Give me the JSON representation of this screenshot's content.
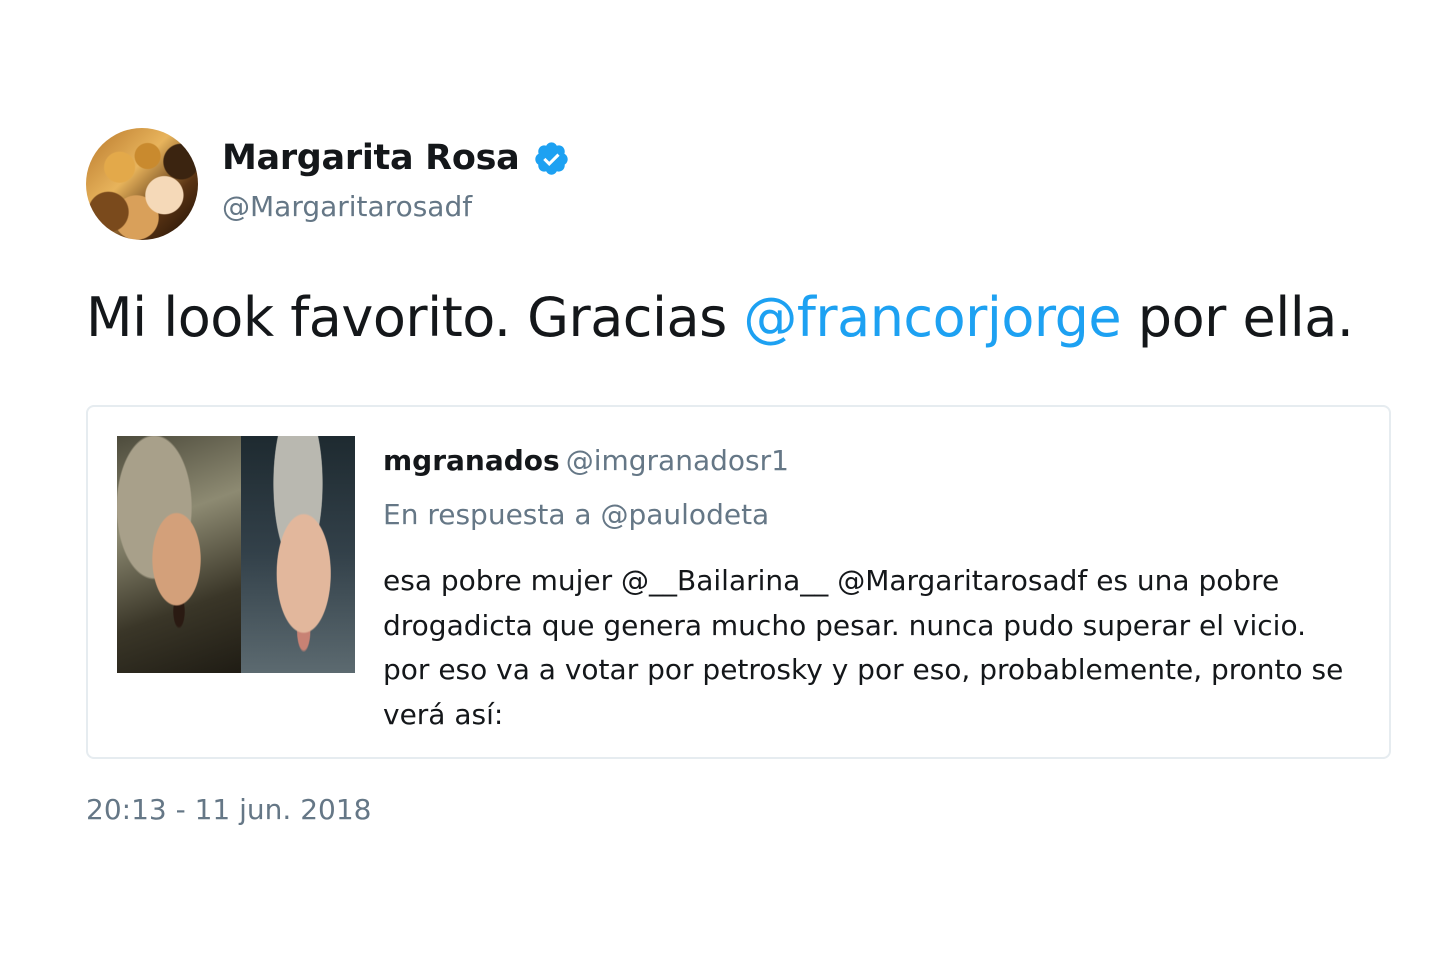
{
  "tweet": {
    "author": {
      "display_name": "Margarita Rosa",
      "handle": "@Margaritarosadf",
      "verified": true,
      "verified_icon": "verified-badge-icon",
      "avatar": "profile-photo"
    },
    "text": {
      "before_mention": "Mi look favorito. Gracias ",
      "mention": "@francorjorge",
      "after_mention": " por ella."
    },
    "quoted_tweet": {
      "display_name": "mgranados",
      "handle": "@imgranadosr1",
      "reply_label": "En respuesta a @paulodeta",
      "text": "esa pobre mujer @__Bailarina__ @Margaritarosadf es una pobre drogadicta que genera mucho pesar. nunca pudo superar el vicio. por eso va a votar por petrosky y por eso, probablemente, pronto se verá así:",
      "media": "two-face-photos"
    },
    "timestamp": "20:13 - 11 jun. 2018"
  },
  "colors": {
    "link": "#1da1f2",
    "text": "#14171a",
    "secondary": "#657786",
    "border": "#e6ecf0"
  }
}
